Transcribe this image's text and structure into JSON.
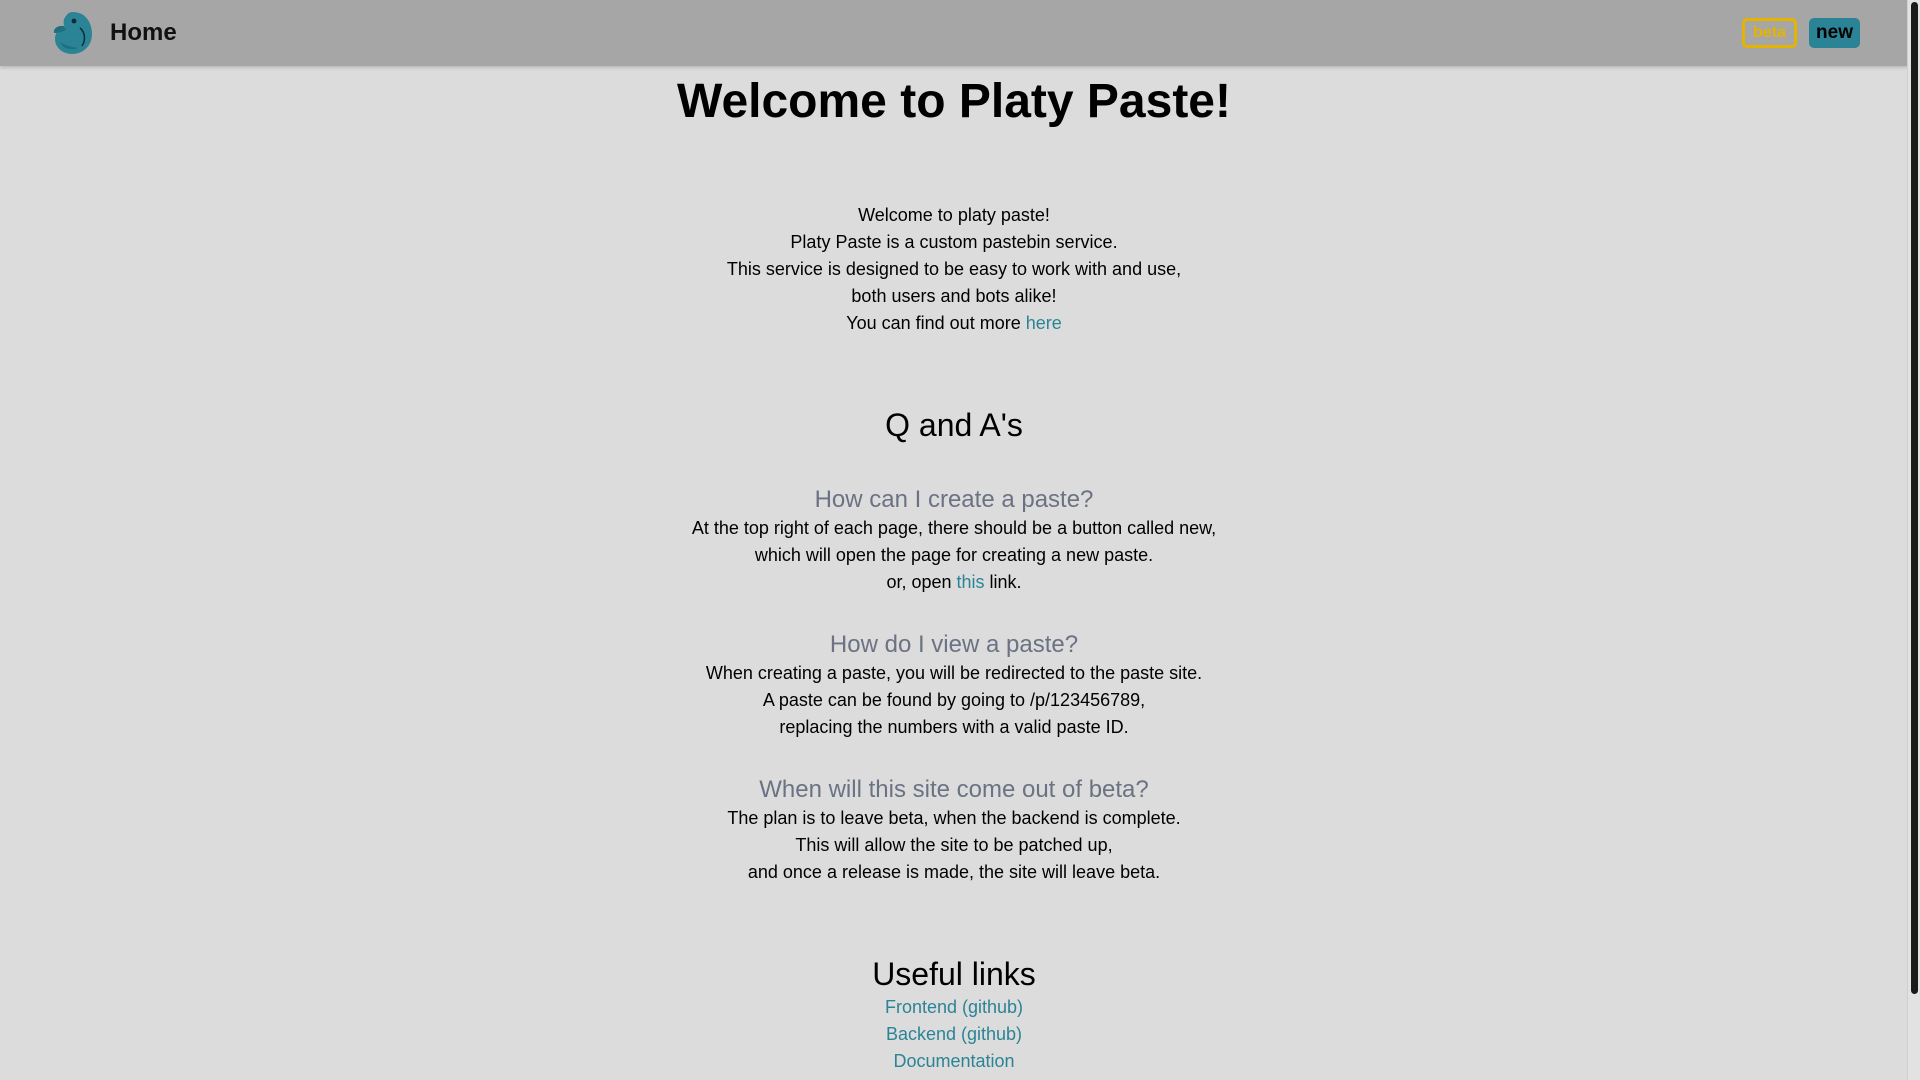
{
  "nav": {
    "home_label": "Home",
    "beta_label": "beta",
    "new_label": "new",
    "logo_icon": "platypus-logo-icon"
  },
  "main": {
    "title": "Welcome to Platy Paste!",
    "intro": {
      "line1": "Welcome to platy paste!",
      "line2": "Platy Paste is a custom pastebin service.",
      "line3": "This service is designed to be easy to work with and use,",
      "line4": "both users and bots alike!",
      "line5_prefix": "You can find out more ",
      "line5_link": "here"
    },
    "qa": {
      "heading": "Q and A's",
      "items": [
        {
          "question": "How can I create a paste?",
          "line1": "At the top right of each page, there should be a button called new,",
          "line2": "which will open the page for creating a new paste.",
          "line3_prefix": "or, open ",
          "line3_link": "this",
          "line3_suffix": " link."
        },
        {
          "question": "How do I view a paste?",
          "line1": "When creating a paste, you will be redirected to the paste site.",
          "line2": "A paste can be found by going to /p/123456789,",
          "line3": "replacing the numbers with a valid paste ID."
        },
        {
          "question": "When will this site come out of beta?",
          "line1": "The plan is to leave beta, when the backend is complete.",
          "line2": "This will allow the site to be patched up,",
          "line3": "and once a release is made, the site will leave beta."
        }
      ]
    },
    "links": {
      "heading": "Useful links",
      "items": [
        "Frontend (github)",
        "Backend (github)",
        "Documentation"
      ]
    }
  },
  "colors": {
    "page_bg": "#dcdcdc",
    "navbar_bg": "#a6a6a6",
    "accent": "#2b8496",
    "beta": "#e5b400",
    "question": "#6b7283"
  }
}
